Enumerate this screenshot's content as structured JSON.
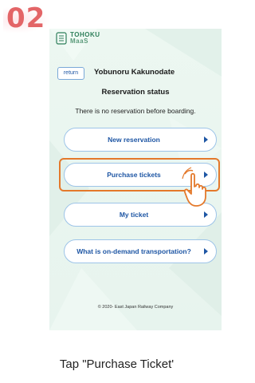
{
  "step": {
    "number": "02"
  },
  "app": {
    "logo_line1": "TOHOKU",
    "logo_line2": "MaaS",
    "return_label": "return",
    "service_name": "Yobunoru Kakunodate",
    "status_title": "Reservation status",
    "status_message": "There is no reservation before boarding.",
    "menu": [
      {
        "label": "New reservation"
      },
      {
        "label": "Purchase tickets"
      },
      {
        "label": "My ticket"
      },
      {
        "label": "What is on-demand transportation?"
      }
    ],
    "copyright": "© 2020- East Japan Railway Company"
  },
  "caption": "Tap \"Purchase Ticket'",
  "colors": {
    "step_number": "#e36567",
    "highlight": "#e4792b",
    "button_text": "#1e56a4",
    "background": "#e9f5ef"
  },
  "icons": [
    "logo-icon",
    "chevron-right-icon",
    "tap-hand-icon"
  ]
}
